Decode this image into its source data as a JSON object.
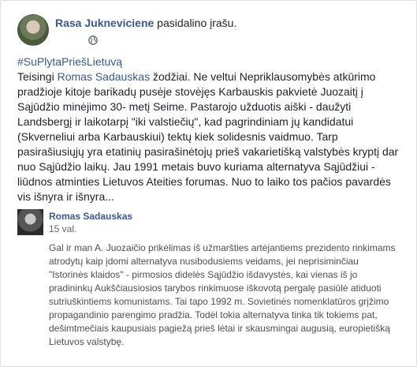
{
  "post": {
    "author": "Rasa Jukneviciene",
    "action": " pasidalino įrašu.",
    "hashtag": "#SuPlytaPriešLietuvą",
    "body_prefix": "Teisingi ",
    "mention": "Romas Sadauskas",
    "body_first_rest": " žodžiai. Ne veltui Nepriklausomybės atkūrimo",
    "body_lines": [
      "pradžioje kitoje barikadų pusėje stovėjęs Karbauskis pakvietė Juozaitį į",
      "Sąjūdžio minėjimo 30- metį Seime. Pastarojo užduotis aiški - daužyti",
      "Landsbergį ir laikotarpį \"iki valstiečių\", kad pagrindiniam jų kandidatui",
      "(Skverneliui arba Karbauskiui) tektų kiek solidesnis vaidmuo. Tarp",
      "pasirašiusiųjų yra etatinių pasirašinėtojų prieš vakarietišką valstybės kryptį dar",
      "nuo Sąjūdžio laikų. Jau 1991 metais buvo kuriama alternatyva Sąjūdžiui -",
      "liūdnos atminties Lietuvos Ateities forumas. Nuo to laiko tos pačios pavardės",
      "vis išnyra ir išnyra..."
    ]
  },
  "quoted": {
    "author": "Romas Sadauskas",
    "time": "15 val.",
    "lines": [
      "Gal ir man A. Juozaičio prikėlimas iš užmaršties artėjantiems prezidento rinkimams",
      "atrodytų kaip įdomi alternatyva nusibodusiems veidams, jei neprisiminčiau",
      "\"Istorinės klaidos\" - pirmosios didelės Sąjūdžio išdavystės, kai vienas iš jo",
      "pradininkų Aukščiausiosios tarybos rinkimuose iškovotą pergalę pasiūlė atiduoti",
      "sutriuškintiems komunistams. Tai tapo 1992 m. Sovietinės nomenklatūros grįžimo",
      "propagandinio parengimo pradžia. Todėl tokia alternatyva tinka tik tokiems pat,",
      "dešimtmečiais kaupusiais pagiežą prieš lėtai ir skausmingai augusią, europietišką",
      "Lietuvos valstybę."
    ]
  }
}
